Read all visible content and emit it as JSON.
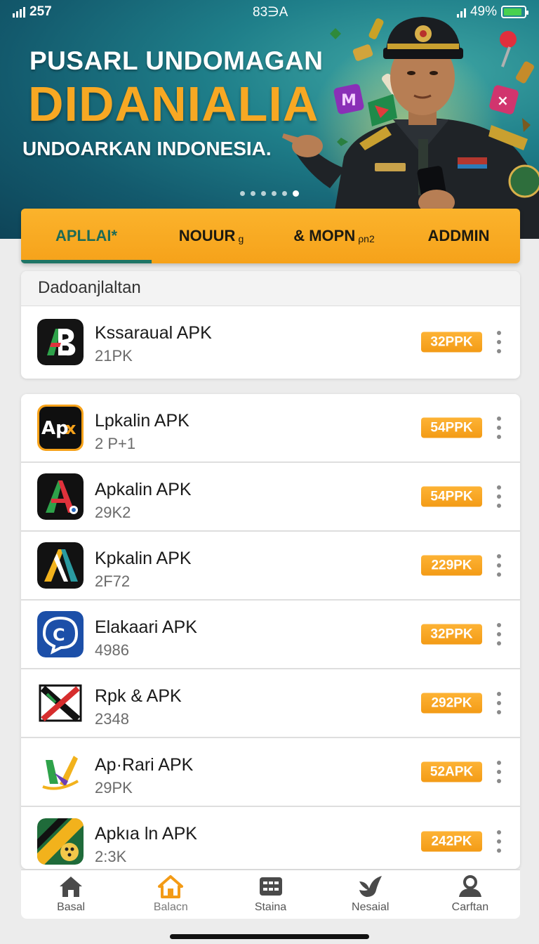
{
  "status_bar": {
    "signal_text": "257",
    "time": "83∋A",
    "battery_percent": "49%",
    "battery_level": 0.9,
    "battery_color": "#48d14f"
  },
  "hero": {
    "title_line1": "PUSARL UNDOMAGAN",
    "title_line2": "DIDANIALIA",
    "subtitle": "UNDOARKAN INDONESIA.",
    "carousel_total": 6,
    "carousel_active": 6,
    "accent_color": "#f7a823"
  },
  "tabs": [
    {
      "label": "APLLAI*",
      "sub": "",
      "active": true
    },
    {
      "label": "NOUUR",
      "sub": "g",
      "active": false
    },
    {
      "label": "& MOPN",
      "sub": "ρn2",
      "active": false
    },
    {
      "label": "ADDMIN",
      "sub": "",
      "active": false
    }
  ],
  "featured": {
    "header": "Dadoanjlaltan",
    "items": [
      {
        "name": "Kssaraual APK",
        "sub": "21PK",
        "badge": "32PPK",
        "icon": "letter-b-icon"
      }
    ]
  },
  "apps": [
    {
      "name": "Lpkalin APK",
      "sub": "2 P+1",
      "badge": "54PPK",
      "icon": "apx-icon"
    },
    {
      "name": "Apkalin APK",
      "sub": "29K2",
      "badge": "54PPK",
      "icon": "letter-a-icon"
    },
    {
      "name": "Kpkalin APK",
      "sub": "2F72",
      "badge": "229PK",
      "icon": "letter-a-yellow-icon"
    },
    {
      "name": "Elakaari APK",
      "sub": "4986",
      "badge": "32PPK",
      "icon": "chat-bubble-icon"
    },
    {
      "name": "Rpk & APK",
      "sub": "2348",
      "badge": "292PK",
      "icon": "cross-icon"
    },
    {
      "name": "Ap·Rari APK",
      "sub": "29PK",
      "badge": "52APK",
      "icon": "check-ribbon-icon"
    },
    {
      "name": "Apkıa ln APK",
      "sub": "2:3K",
      "badge": "242PK",
      "icon": "ball-icon"
    }
  ],
  "bottom_nav": [
    {
      "label": "Basal",
      "icon": "home-icon",
      "active": false
    },
    {
      "label": "Balacn",
      "icon": "home-outline-icon",
      "active": true
    },
    {
      "label": "Staina",
      "icon": "grid-icon",
      "active": false
    },
    {
      "label": "Nesaial",
      "icon": "bird-icon",
      "active": false
    },
    {
      "label": "Carftan",
      "icon": "person-icon",
      "active": false
    }
  ],
  "colors": {
    "orange": "#f6a21a",
    "teal": "#1e7566",
    "nav_active": "#f39b16"
  }
}
